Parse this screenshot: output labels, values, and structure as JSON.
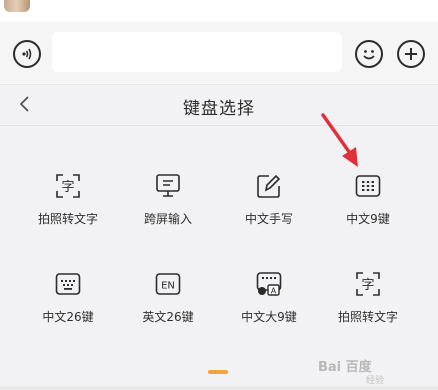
{
  "header": {
    "title": "键盘选择"
  },
  "input": {
    "placeholder": ""
  },
  "keyboards": [
    {
      "label": "拍照转文字",
      "icon": "photo-text-icon"
    },
    {
      "label": "跨屏输入",
      "icon": "monitor-icon"
    },
    {
      "label": "中文手写",
      "icon": "handwrite-icon"
    },
    {
      "label": "中文9键",
      "icon": "keypad9-icon"
    },
    {
      "label": "中文26键",
      "icon": "keyboard26-icon"
    },
    {
      "label": "英文26键",
      "icon": "en-icon",
      "icon_text": "EN"
    },
    {
      "label": "中文大9键",
      "icon": "big9-icon",
      "icon_text": "A"
    },
    {
      "label": "拍照转文字",
      "icon": "photo-text-icon",
      "icon_text": "字"
    }
  ],
  "photo_icon_text": "字",
  "watermark": {
    "brand": "Bai 百度",
    "sub": "经验"
  },
  "colors": {
    "accent": "#f4a23a",
    "arrow": "#e0303a",
    "text": "#2c2c2c"
  }
}
